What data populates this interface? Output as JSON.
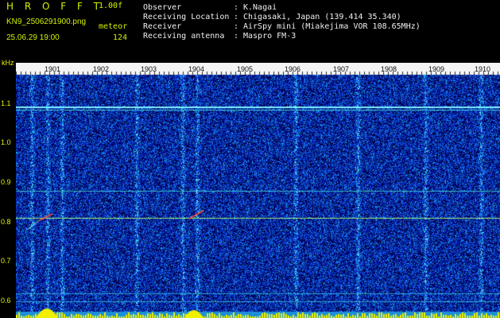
{
  "header": {
    "app_title": "H R O F F T",
    "version": "1.00f",
    "filename": "KN9_2506291900.png",
    "mode": "meteor",
    "datetime": "25.06.29 19:00",
    "count": "124",
    "rows": [
      {
        "label": "Observer",
        "value": "K.Nagai"
      },
      {
        "label": "Receiving Location",
        "value": "Chigasaki, Japan (139.414 35.340)"
      },
      {
        "label": "Receiver",
        "value": "AirSpy mini (Miakejima VOR 108.65MHz)"
      },
      {
        "label": "Receiving antenna",
        "value": "Maspro FM-3"
      }
    ],
    "colon": ":"
  },
  "axis": {
    "unit": "kHz",
    "y_ticks": [
      "1.1",
      "1.0",
      "0.9",
      "0.8",
      "0.7",
      "0.6"
    ],
    "x_ticks": [
      "1901",
      "1902",
      "1903",
      "1904",
      "1905",
      "1906",
      "1907",
      "1908",
      "1909",
      "1910"
    ]
  },
  "colors": {
    "background": "#000000",
    "title": "#d4f000",
    "text": "#f0f0f0",
    "noise": "#1f2dc8",
    "signal": "#3fd0e0",
    "meteor": "#e8f000",
    "meteor_head": "#ff4030"
  }
}
